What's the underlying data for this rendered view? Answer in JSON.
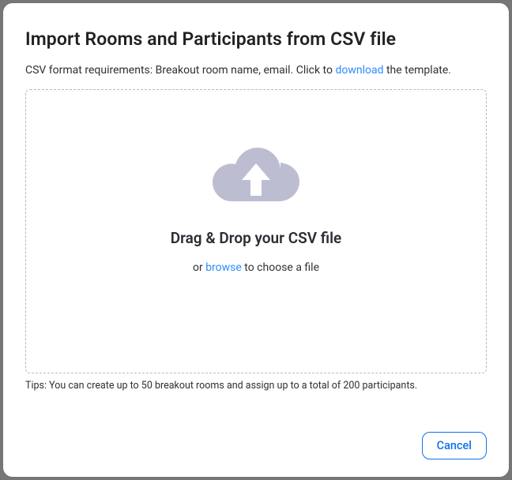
{
  "dialog": {
    "title": "Import Rooms and Participants from CSV file",
    "requirements_prefix": "CSV format requirements: Breakout room name, email. Click to ",
    "download_link": "download",
    "requirements_suffix": " the template.",
    "drop_title": "Drag & Drop your CSV file",
    "drop_or": "or ",
    "browse_link": "browse",
    "drop_or_suffix": " to choose a file",
    "tips": "Tips: You can create up to 50 breakout rooms and assign up to a total of 200 participants.",
    "cancel_label": "Cancel"
  },
  "colors": {
    "link": "#2d8cff",
    "button_border": "#0e72ed",
    "cloud": "#bdbdd2"
  }
}
